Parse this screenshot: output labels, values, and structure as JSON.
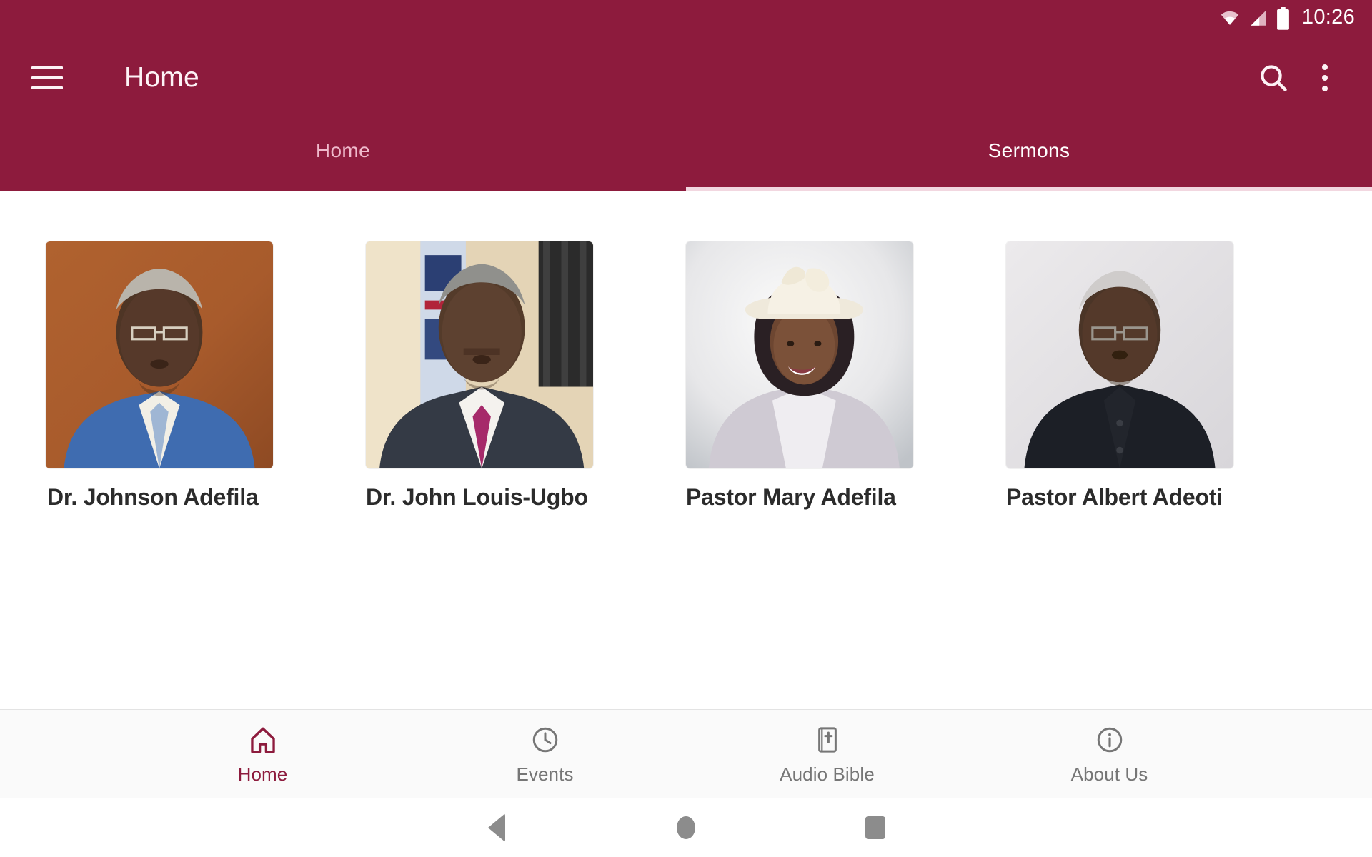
{
  "theme": {
    "primary": "#8d1b3d",
    "primary_text": "#fdf3f6",
    "tab_inactive": "#efb9cb",
    "tab_active": "#ffffff",
    "nav_active": "#8d1b3d",
    "nav_idle": "#767676",
    "content_bg": "#ffffff",
    "bottom_nav_bg": "#fafafa"
  },
  "statusbar": {
    "time": "10:26",
    "icons": [
      "wifi-icon",
      "cellular-signal-icon",
      "battery-icon"
    ]
  },
  "toolbar": {
    "menu_icon": "hamburger-menu-icon",
    "title": "Home",
    "search_icon": "search-icon",
    "overflow_icon": "overflow-menu-icon"
  },
  "tabs": {
    "items": [
      {
        "label": "Home",
        "active": false
      },
      {
        "label": "Sermons",
        "active": true
      }
    ],
    "selected_index": 1
  },
  "sermons": {
    "cards": [
      {
        "name": "Dr. Johnson Adefila",
        "image": "portrait-man-blue-suit-orange-background"
      },
      {
        "name": "Dr. John Louis-Ugbo",
        "image": "portrait-man-dark-suit-magenta-tie"
      },
      {
        "name": "Pastor Mary Adefila",
        "image": "portrait-woman-white-hat-silver-jacket"
      },
      {
        "name": "Pastor Albert Adeoti",
        "image": "portrait-elder-man-black-suit-grey-background"
      }
    ]
  },
  "bottom_nav": {
    "items": [
      {
        "label": "Home",
        "icon": "home-icon",
        "active": true
      },
      {
        "label": "Events",
        "icon": "clock-icon",
        "active": false
      },
      {
        "label": "Audio Bible",
        "icon": "bible-book-icon",
        "active": false
      },
      {
        "label": "About Us",
        "icon": "info-circle-icon",
        "active": false
      }
    ]
  },
  "system_nav": {
    "back": "back-triangle-icon",
    "home": "home-circle-icon",
    "recents": "recents-square-icon"
  }
}
